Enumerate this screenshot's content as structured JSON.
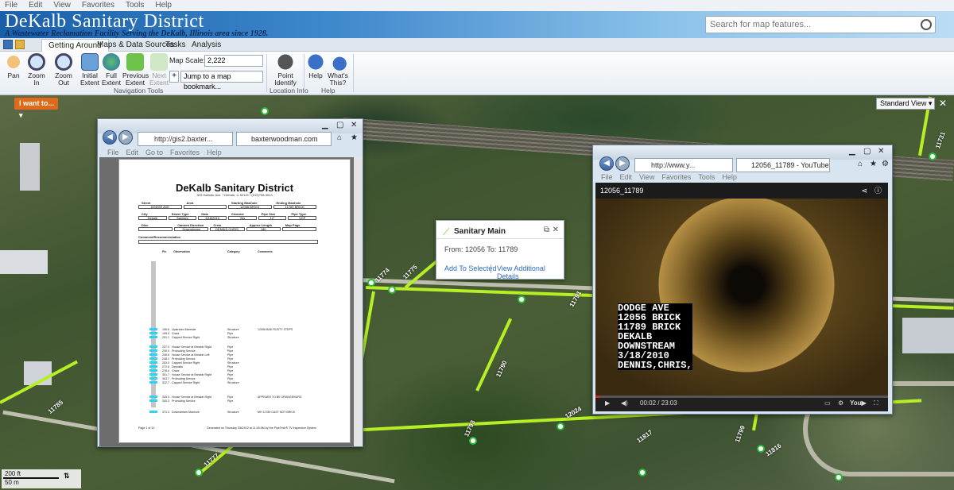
{
  "app_menu": [
    "File",
    "Edit",
    "View",
    "Favorites",
    "Tools",
    "Help"
  ],
  "banner": {
    "title": "DeKalb Sanitary District",
    "subtitle": "A Wastewater Reclamation Facility Serving the DeKalb, Illinois area since 1928."
  },
  "search": {
    "placeholder": "Search for map features..."
  },
  "tabs": [
    "Getting Around",
    "Maps & Data Sources",
    "Tasks",
    "Analysis"
  ],
  "ribbon": {
    "nav_buttons": [
      {
        "label": "Pan"
      },
      {
        "label": "Zoom In"
      },
      {
        "label": "Zoom Out"
      },
      {
        "label": "Initial Extent"
      },
      {
        "label": "Full Extent"
      },
      {
        "label": "Previous Extent"
      },
      {
        "label": "Next Extent"
      }
    ],
    "map_scale_label": "Map Scale: 1:",
    "map_scale_value": "2,222",
    "bookmark": "Jump to a map bookmark...",
    "group_nav": "Navigation Tools",
    "point_identify": "Point Identify",
    "group_location": "Location Info",
    "help": "Help",
    "whats_this": "What's This?",
    "group_help": "Help"
  },
  "map": {
    "i_want_to": "I want to...",
    "standard_view": "Standard View",
    "pipe_labels": [
      "11774",
      "11775",
      "11791",
      "11790",
      "11793",
      "11785",
      "12031",
      "11789",
      "11816",
      "11799",
      "12036",
      "11777",
      "12024",
      "11817",
      "11731"
    ]
  },
  "browser1": {
    "address": "http://gis2.baxter...",
    "tab": "baxterwoodman.com",
    "menu": [
      "File",
      "Edit",
      "Go to",
      "Favorites",
      "Help"
    ],
    "doc": {
      "title": "DeKalb Sanitary District",
      "address": "303 Hollister Ave. * DeKalb, IL 60115 * (815)758-3513",
      "fields_row1": [
        "Street",
        "Area",
        "Starting Manhole",
        "Ending Manhole"
      ],
      "values_row1": [
        "DODGE AVE",
        "",
        "12056 BRICK",
        "11789 BRICK"
      ],
      "fields_row2": [
        "City",
        "Sewer Type",
        "Date",
        "Cleaned",
        "Pipe Size",
        "Pipe Type"
      ],
      "values_row2": [
        "Dekalb",
        "Sanitary",
        "3/18/2010",
        "Yes",
        "12\"",
        "VCP"
      ],
      "fields_row3": [
        "Disc",
        "Camera Direction",
        "Crew",
        "Approx Length",
        "Map Page"
      ],
      "values_row3": [
        "",
        "Downstream",
        "DENNIS,CHRIS,",
        "180",
        ""
      ],
      "comment": "Comment/Recommendation",
      "observation_headers": [
        "Pic",
        "Observation",
        "Category",
        "Comments"
      ],
      "observations": [
        {
          "dist": "196.8",
          "obs": "Upstream Manhole",
          "cat": "Structure",
          "cmt": "12056 BAD RUSTY STEPS"
        },
        {
          "dist": "199.0",
          "obs": "Crack",
          "cat": "Pipe",
          "cmt": ""
        },
        {
          "dist": "201.1",
          "obs": "Capped Service Right",
          "cat": "Structure",
          "cmt": ""
        },
        {
          "dist": "237.0",
          "obs": "House Service at Breakin Right",
          "cat": "Pipe",
          "cmt": ""
        },
        {
          "dist": "239.0",
          "obs": "Protruding Service",
          "cat": "Pipe",
          "cmt": ""
        },
        {
          "dist": "246.6",
          "obs": "House Service at Breakin Left",
          "cat": "Pipe",
          "cmt": ""
        },
        {
          "dist": "248.1",
          "obs": "Protruding Service",
          "cat": "Pipe",
          "cmt": ""
        },
        {
          "dist": "253.0",
          "obs": "Capped Service Right",
          "cat": "Structure",
          "cmt": ""
        },
        {
          "dist": "272.6",
          "obs": "Deposits",
          "cat": "Pipe",
          "cmt": ""
        },
        {
          "dist": "278.0",
          "obs": "Crack",
          "cat": "Pipe",
          "cmt": ""
        },
        {
          "dist": "301.7",
          "obs": "House Service at Breakin Right",
          "cat": "Pipe",
          "cmt": ""
        },
        {
          "dist": "303.7",
          "obs": "Protruding Service",
          "cat": "Pipe",
          "cmt": ""
        },
        {
          "dist": "322.7",
          "obs": "Capped Service Right",
          "cat": "Structure",
          "cmt": ""
        },
        {
          "dist": "340.3",
          "obs": "House Service at Breakin Right",
          "cat": "Pipe",
          "cmt": "APPEARS TO BE ORANGEBURG"
        },
        {
          "dist": "340.3",
          "obs": "Protruding Service",
          "cat": "Pipe",
          "cmt": ""
        },
        {
          "dist": "373.3",
          "obs": "Downstream Manhole",
          "cat": "Structure",
          "cmt": "MH 11789 CAST NOT BRICK"
        }
      ],
      "footer_left": "Page 1 of 10",
      "footer_right": "Generated on Thursday 3/8/2012 at 11:45 AM by the PipeTech® TV Inspection System"
    }
  },
  "popup": {
    "title": "Sanitary Main",
    "body": "From: 12056 To: 11789",
    "link1": "Add To Selected",
    "link2": "View Additional Details"
  },
  "browser2": {
    "address": "http://www.y...",
    "tab": "12056_11789 - YouTube",
    "menu": [
      "File",
      "Edit",
      "View",
      "Favorites",
      "Tools",
      "Help"
    ],
    "video_title": "12056_11789",
    "overlay": "DODGE AVE\n12056 BRICK\n11789 BRICK\nDEKALB\nDOWNSTREAM\n3/18/2010\nDENNIS,CHRIS,",
    "time": "00:02 / 23:03",
    "progress": 0.0015
  },
  "scalebar": {
    "top": "200 ft",
    "bottom": "50 m"
  }
}
